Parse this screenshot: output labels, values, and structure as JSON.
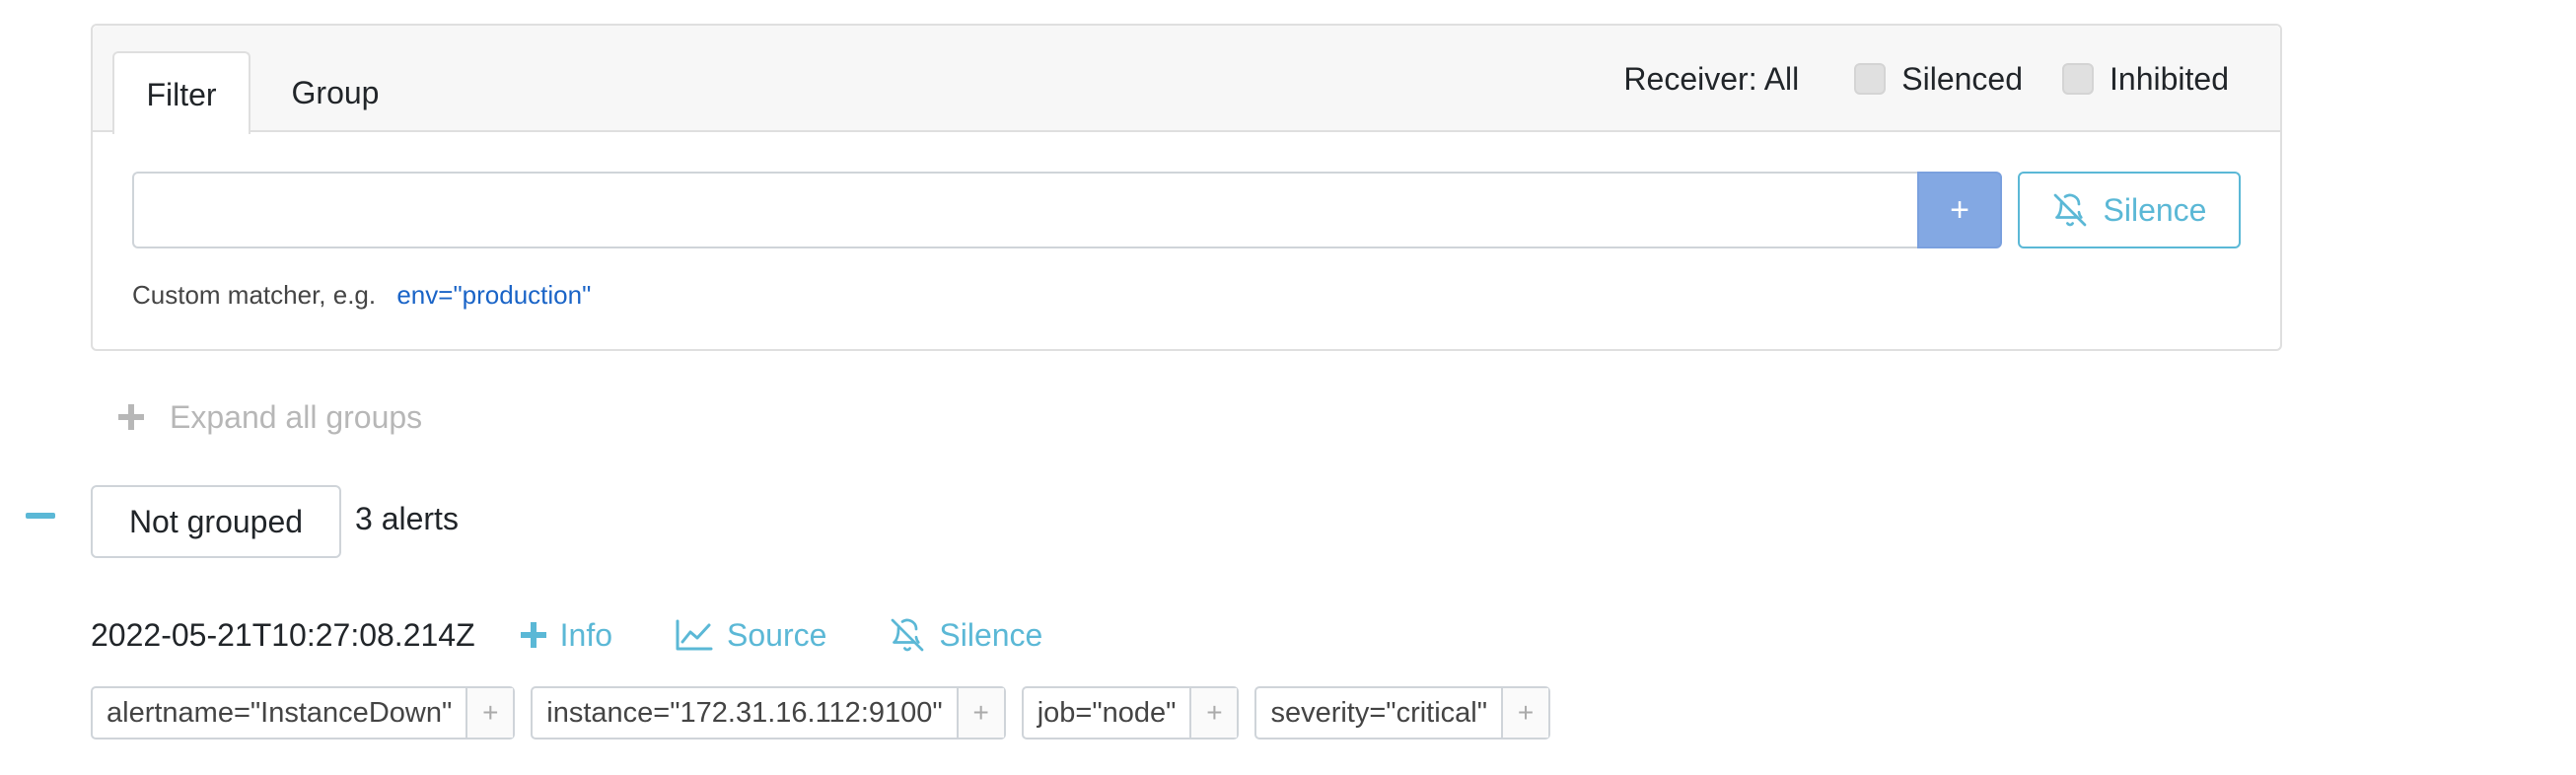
{
  "filter_panel": {
    "tabs": [
      {
        "label": "Filter",
        "active": true
      },
      {
        "label": "Group",
        "active": false
      }
    ],
    "receiver_label": "Receiver: All",
    "checkboxes": [
      {
        "label": "Silenced",
        "checked": false
      },
      {
        "label": "Inhibited",
        "checked": false
      }
    ],
    "matcher_input": {
      "value": "",
      "placeholder": ""
    },
    "add_button_label": "+",
    "silence_button_label": "Silence",
    "hint_text": "Custom matcher, e.g.",
    "hint_example": "env=\"production\""
  },
  "expand_all_label": "Expand all groups",
  "group": {
    "name": "Not grouped",
    "alert_count": "3 alerts",
    "alerts": [
      {
        "timestamp": "2022-05-21T10:27:08.214Z",
        "actions": {
          "info": "Info",
          "source": "Source",
          "silence": "Silence"
        },
        "labels": [
          "alertname=\"InstanceDown\"",
          "instance=\"172.31.16.112:9100\"",
          "job=\"node\"",
          "severity=\"critical\""
        ],
        "label_add": "+"
      }
    ]
  },
  "colors": {
    "accent": "#5bb8d6",
    "primary_button": "#83a8e3",
    "link": "#1a64c7",
    "muted": "#b7b7b7"
  },
  "icons": {
    "silence": "bell-slash-icon",
    "info": "plus-icon",
    "source": "chart-line-icon",
    "expand": "plus-icon",
    "collapse": "minus-icon"
  }
}
